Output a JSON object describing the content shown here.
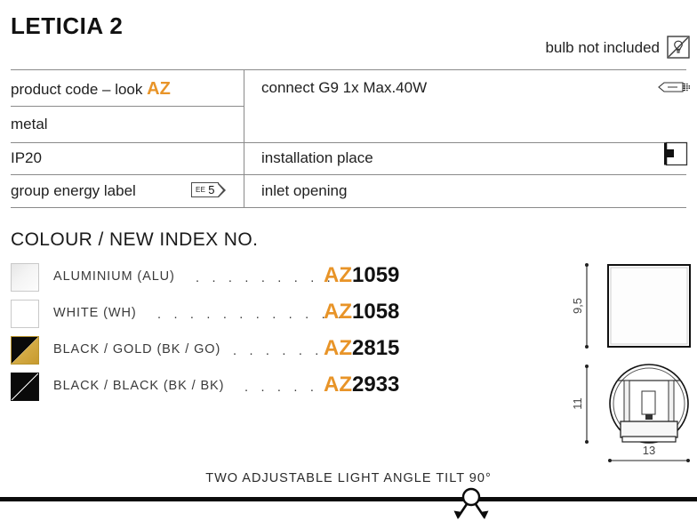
{
  "product": {
    "title": "LETICIA 2",
    "bulb_note": "bulb not included",
    "bulb_icon": "bulb-crossed-out-icon"
  },
  "spec_table": {
    "left_column": [
      {
        "label": "product code – look",
        "accent": "AZ",
        "name": "product-code-row"
      },
      {
        "label": "metal",
        "name": "material-row"
      },
      {
        "label": "IP20",
        "name": "ip-rating-row"
      },
      {
        "label": "group energy label",
        "badge": {
          "prefix": "EE",
          "value": "5"
        },
        "name": "energy-label-row"
      }
    ],
    "right_column": [
      {
        "label": "connect G9 1x Max.40W",
        "icon": "g9-bulb-icon",
        "name": "connect-row"
      },
      {
        "label": "installation place",
        "icon": "wall-mount-icon",
        "name": "installation-place-row"
      },
      {
        "label": "inlet opening",
        "name": "inlet-opening-row"
      }
    ]
  },
  "colour_section": {
    "heading": "COLOUR / NEW INDEX NO.",
    "items": [
      {
        "swatch": "aluminium-swatch",
        "label": "ALUMINIUM (ALU)",
        "dots": ". . . . . . . . .",
        "code_prefix": "AZ",
        "code_number": "1059"
      },
      {
        "swatch": "white-swatch",
        "label": "WHITE (WH)",
        "dots": ". . . . . . . . . . . .",
        "code_prefix": "AZ",
        "code_number": "1058"
      },
      {
        "swatch": "black-gold-swatch",
        "label": "BLACK / GOLD (BK / GO)",
        "dots": ". . . . . .",
        "code_prefix": "AZ",
        "code_number": "2815"
      },
      {
        "swatch": "black-black-swatch",
        "label": "BLACK / BLACK (BK / BK)",
        "dots": ". . . . .",
        "code_prefix": "AZ",
        "code_number": "2933"
      }
    ]
  },
  "technical_drawing": {
    "front_view": {
      "name": "front-view-square",
      "height_label": "9,5"
    },
    "side_view": {
      "name": "side-view-circle",
      "height_label": "11",
      "width_label": "13"
    }
  },
  "footer": {
    "text": "TWO ADJUSTABLE LIGHT ANGLE TILT 90°",
    "icon": "tilt-arrows-icon"
  },
  "colors": {
    "accent_orange": "#E89428",
    "text_dark": "#1a1a1a",
    "rule_gray": "#8a8a8a",
    "gold": "#c79a2e"
  }
}
